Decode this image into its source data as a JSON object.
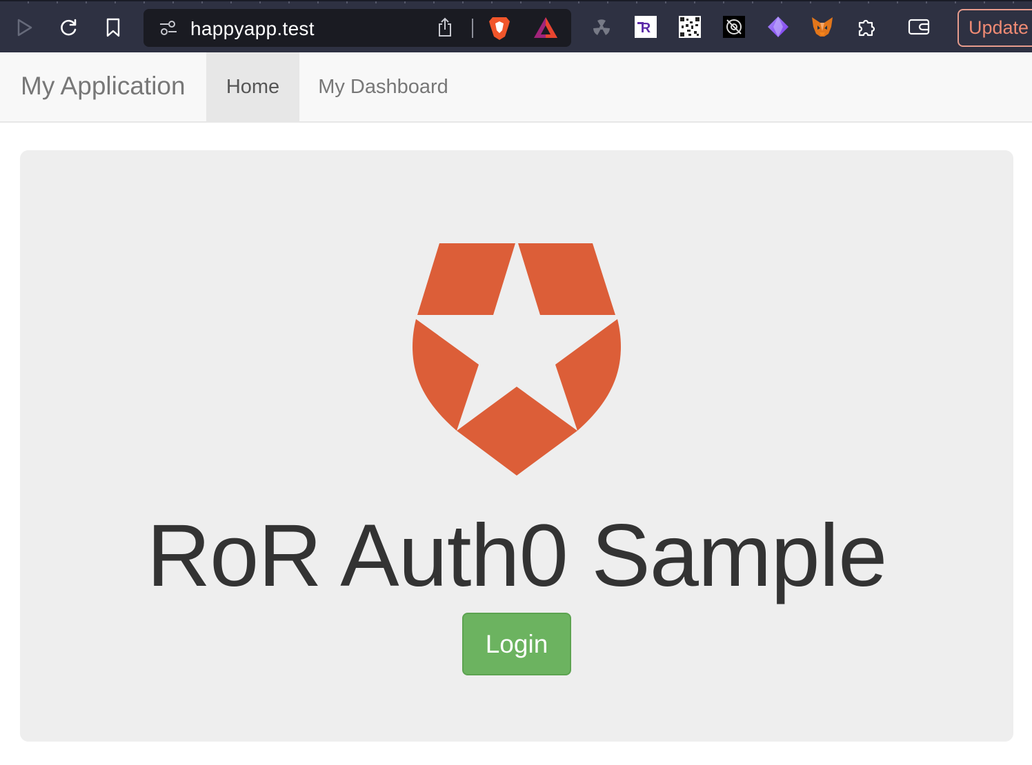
{
  "browser": {
    "url": "happyapp.test",
    "update_label": "Update",
    "icons": [
      "play-icon",
      "reload-icon",
      "bookmark-icon",
      "site-settings-icon",
      "share-icon",
      "brave-shields-icon",
      "brave-rewards-icon",
      "radioactive-extension-icon",
      "r-extension-icon",
      "qr-extension-icon",
      "dark-extension-icon",
      "gem-extension-icon",
      "metamask-fox-icon",
      "extensions-puzzle-icon",
      "wallet-icon"
    ]
  },
  "navbar": {
    "brand": "My Application",
    "items": [
      {
        "label": "Home",
        "active": true
      },
      {
        "label": "My Dashboard",
        "active": false
      }
    ]
  },
  "jumbotron": {
    "logo": "auth0-shield-star-logo",
    "title": "RoR Auth0 Sample",
    "login_label": "Login"
  },
  "colors": {
    "logo": "#dc5e38",
    "login_button": "#6cb360",
    "jumbotron_bg": "#eeeeee",
    "navbar_bg": "#f8f8f8",
    "chrome_bg": "#2e3142"
  }
}
